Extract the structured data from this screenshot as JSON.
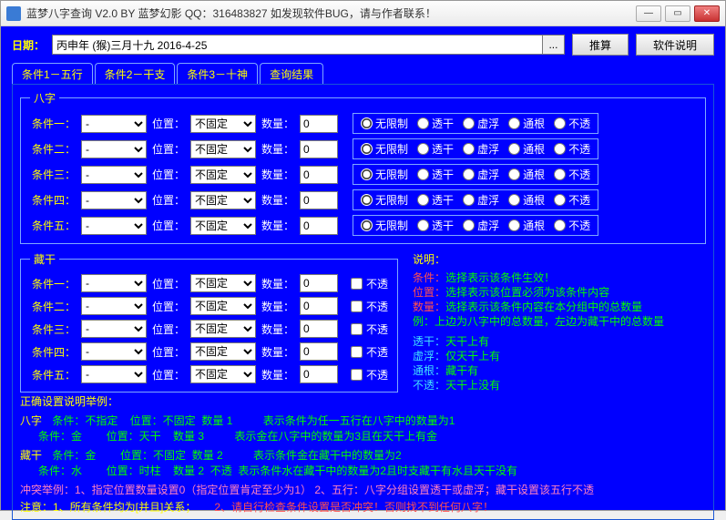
{
  "window": {
    "title": "蓝梦八字查询 V2.0 BY 蓝梦幻影 QQ：316483827 如发现软件BUG，请与作者联系！"
  },
  "top": {
    "date_label": "日期：",
    "date_value": "丙申年 (猴)三月十九 2016-4-25",
    "calc_btn": "推算",
    "help_btn": "软件说明"
  },
  "tabs": [
    "条件1－五行",
    "条件2－干支",
    "条件3－十神",
    "查询结果"
  ],
  "group_bazi": {
    "legend": "八字",
    "rows": [
      "条件一：",
      "条件二：",
      "条件三：",
      "条件四：",
      "条件五："
    ],
    "pos_label": "位置：",
    "pos_value": "不固定",
    "qty_label": "数量：",
    "qty_value": "0",
    "sel_value": "-",
    "radios": [
      "无限制",
      "透干",
      "虚浮",
      "通根",
      "不透"
    ]
  },
  "group_cang": {
    "legend": "藏干",
    "rows": [
      "条件一：",
      "条件二：",
      "条件三：",
      "条件四：",
      "条件五："
    ],
    "pos_label": "位置：",
    "pos_value": "不固定",
    "qty_label": "数量：",
    "qty_value": "0",
    "sel_value": "-",
    "chk_label": "不透"
  },
  "explain": {
    "header": "说明：",
    "l1a": "条件：",
    "l1b": "选择表示该条件生效！",
    "l2a": "位置：",
    "l2b": "选择表示该位置必须为该条件内容",
    "l3a": "数量：",
    "l3b": "选择表示该条件内容在本分组中的总数量",
    "l4": "例：上边为八字中的总数量，左边为藏干中的总数量",
    "l5a": "透干：",
    "l5b": "天干上有",
    "l6a": "虚浮：",
    "l6b": "仅天干上有",
    "l7a": "通根：",
    "l7b": "藏干有",
    "l8a": "不透：",
    "l8b": "天干上没有"
  },
  "example": {
    "header": "正确设置说明举例：",
    "r1_lead": "八字",
    "r1a": " 条件：不指定    位置：不固定  数量 1          表示条件为任一五行在八字中的数量为1",
    "r1b": "      条件：金        位置：天干    数量 3          表示金在八字中的数量为3且在天干上有金",
    "r2_lead": "藏干",
    "r2a": " 条件：金        位置：不固定  数量 2          表示条件金在藏干中的数量为2",
    "r2b": "      条件：水        位置：时柱    数量 2  不透  表示条件水在藏干中的数量为2且时支藏干有水且天干没有",
    "conflict": "冲突举例：1、指定位置数量设置0（指定位置肯定至少为1） 2、五行：八字分组设置透干或虚浮；藏干设置该五行不透",
    "notice_a": "注意：1、所有条件均为[并且]关系；",
    "notice_b": "2、请自行检查条件设置是否冲突！否则找不到任何八字！"
  }
}
